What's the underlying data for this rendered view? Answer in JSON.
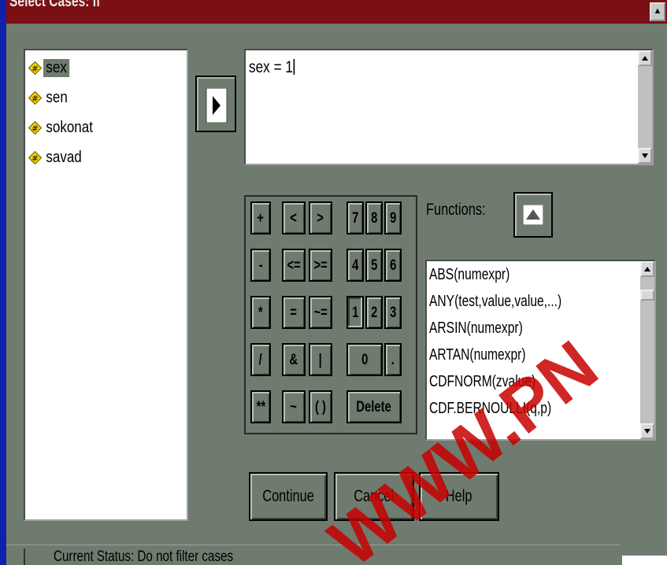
{
  "window": {
    "title": "Select Cases: If",
    "close_glyph": "▲"
  },
  "variables": [
    {
      "label": "sex",
      "selected": true
    },
    {
      "label": "sen",
      "selected": false
    },
    {
      "label": "sokonat",
      "selected": false
    },
    {
      "label": "savad",
      "selected": false
    }
  ],
  "expression": {
    "value": "sex = 1"
  },
  "keypad": {
    "keys": [
      "+",
      "<",
      ">",
      "7",
      "8",
      "9",
      "-",
      "<=",
      ">=",
      "4",
      "5",
      "6",
      "*",
      "=",
      "~=",
      "1",
      "2",
      "3",
      "/",
      "&",
      "|",
      "0",
      ".",
      "**",
      "~",
      "( )",
      "Delete"
    ]
  },
  "functions": {
    "label": "Functions:",
    "items": [
      "ABS(numexpr)",
      "ANY(test,value,value,...)",
      "ARSIN(numexpr)",
      "ARTAN(numexpr)",
      "CDFNORM(zvalue)",
      "CDF.BERNOULLI(q,p)"
    ]
  },
  "buttons": {
    "continue": "Continue",
    "cancel": "Cancel",
    "help": "Help"
  },
  "status": {
    "text": "Current Status: Do not filter cases"
  },
  "watermark": {
    "text": "WWW.PN"
  }
}
